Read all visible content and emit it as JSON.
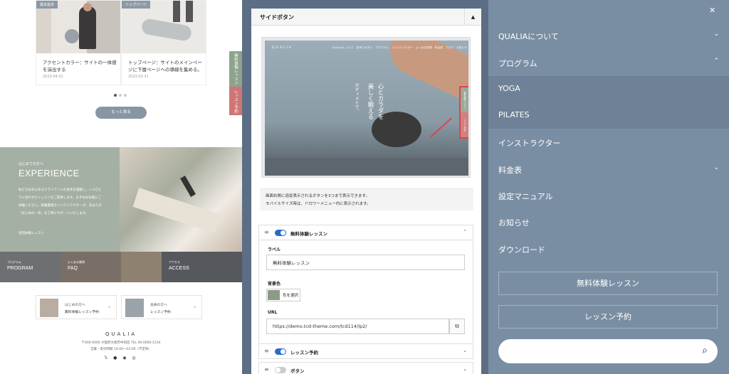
{
  "left": {
    "cards": [
      {
        "tag": "基本設定",
        "title": "アクセントカラー：サイトの一体感を演出する",
        "date": "2023.04.01"
      },
      {
        "tag": "トップページ",
        "title": "トップページ：サイトのメインページに下層ページへの導線を集める。",
        "date": "2023.03.31"
      }
    ],
    "more_label": "もっと見る",
    "side_tab1": "無料体験レッスン",
    "side_tab2": "レッスン予約",
    "experience": {
      "sub": "はじめての方へ",
      "title": "EXPERIENCE",
      "body": "私たちはあらゆるクライアントの身体を理解し、一人ひとりに合わせたレッスンをご提供します。まずはお気軽にご体験ください。経験豊富なインストラクターが、あなたの「はじめの一歩」を丁寧にサポートいたします。",
      "link": "初回体験レッスン"
    },
    "tiles": [
      {
        "sub": "プログラム",
        "label": "PROGRAM"
      },
      {
        "sub": "よくある質問",
        "label": "FAQ"
      },
      {
        "sub": "アクセス",
        "label": "ACCESS"
      }
    ],
    "bottom_cards": [
      {
        "l1": "はじめの方へ",
        "l2": "無料体験レッスン予約"
      },
      {
        "l1": "会員の方へ",
        "l2": "レッスン予約"
      }
    ],
    "footer": {
      "name": "QUALIA",
      "addr": "〒000-0000 大阪府大阪市中央区 TEL 06-0000-1234",
      "hours": "営業・受付時間 10:00〜22:00（不定休）",
      "social": "𝕏 ● ◉ ◎"
    }
  },
  "middle": {
    "title": "サイドボタン",
    "preview": {
      "logo": "QUALIA",
      "nav": "QUALIAについて　初めての方へ　プログラム　インストラクター　よくある質問　料金表　ブログ　お知らせ",
      "v1": "心とカラダを",
      "v1b": "美しく鍛える",
      "v2": "ボディメイク。",
      "tab1": "無料体験レッスン",
      "tab2": "レッスン予約"
    },
    "info1": "画面右側に追従表示されるボタンを3つまで表示できます。",
    "info2": "モバイルサイズ時は、ドロワーメニュー内に表示されます。",
    "rows": [
      {
        "label": "無料体験レッスン",
        "on": true,
        "chev": "⌃"
      },
      {
        "label": "レッスン予約",
        "on": true,
        "chev": "⌄"
      },
      {
        "label": "ボタン",
        "on": false,
        "chev": "⌄"
      }
    ],
    "field_label": "ラベル",
    "label_value": "無料体験レッスン",
    "bg_label": "背景色",
    "color_pick": "色を選択",
    "url_label": "URL",
    "url_value": "https://demo.tcd-theme.com/tcd114/lp2/"
  },
  "right": {
    "menu": [
      {
        "label": "QUALIAについて",
        "chev": "⌄",
        "sub": false
      },
      {
        "label": "プログラム",
        "chev": "⌃",
        "sub": false
      },
      {
        "label": "YOGA",
        "chev": "",
        "sub": true
      },
      {
        "label": "PILATES",
        "chev": "",
        "sub": true
      },
      {
        "label": "インストラクター",
        "chev": "",
        "sub": false
      },
      {
        "label": "料金表",
        "chev": "⌄",
        "sub": false
      },
      {
        "label": "設定マニュアル",
        "chev": "",
        "sub": false
      },
      {
        "label": "お知らせ",
        "chev": "",
        "sub": false
      },
      {
        "label": "ダウンロード",
        "chev": "",
        "sub": false
      }
    ],
    "btn1": "無料体験レッスン",
    "btn2": "レッスン予約",
    "close": "✕",
    "search_icon": "⌕"
  }
}
